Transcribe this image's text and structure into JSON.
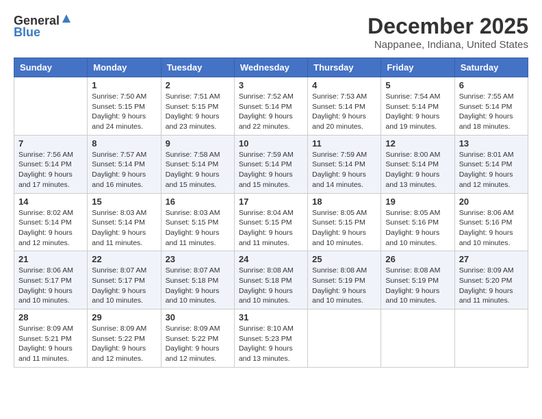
{
  "header": {
    "logo_general": "General",
    "logo_blue": "Blue",
    "title": "December 2025",
    "location": "Nappanee, Indiana, United States"
  },
  "days_of_week": [
    "Sunday",
    "Monday",
    "Tuesday",
    "Wednesday",
    "Thursday",
    "Friday",
    "Saturday"
  ],
  "weeks": [
    [
      {
        "day": "",
        "info": ""
      },
      {
        "day": "1",
        "info": "Sunrise: 7:50 AM\nSunset: 5:15 PM\nDaylight: 9 hours\nand 24 minutes."
      },
      {
        "day": "2",
        "info": "Sunrise: 7:51 AM\nSunset: 5:15 PM\nDaylight: 9 hours\nand 23 minutes."
      },
      {
        "day": "3",
        "info": "Sunrise: 7:52 AM\nSunset: 5:14 PM\nDaylight: 9 hours\nand 22 minutes."
      },
      {
        "day": "4",
        "info": "Sunrise: 7:53 AM\nSunset: 5:14 PM\nDaylight: 9 hours\nand 20 minutes."
      },
      {
        "day": "5",
        "info": "Sunrise: 7:54 AM\nSunset: 5:14 PM\nDaylight: 9 hours\nand 19 minutes."
      },
      {
        "day": "6",
        "info": "Sunrise: 7:55 AM\nSunset: 5:14 PM\nDaylight: 9 hours\nand 18 minutes."
      }
    ],
    [
      {
        "day": "7",
        "info": "Sunrise: 7:56 AM\nSunset: 5:14 PM\nDaylight: 9 hours\nand 17 minutes."
      },
      {
        "day": "8",
        "info": "Sunrise: 7:57 AM\nSunset: 5:14 PM\nDaylight: 9 hours\nand 16 minutes."
      },
      {
        "day": "9",
        "info": "Sunrise: 7:58 AM\nSunset: 5:14 PM\nDaylight: 9 hours\nand 15 minutes."
      },
      {
        "day": "10",
        "info": "Sunrise: 7:59 AM\nSunset: 5:14 PM\nDaylight: 9 hours\nand 15 minutes."
      },
      {
        "day": "11",
        "info": "Sunrise: 7:59 AM\nSunset: 5:14 PM\nDaylight: 9 hours\nand 14 minutes."
      },
      {
        "day": "12",
        "info": "Sunrise: 8:00 AM\nSunset: 5:14 PM\nDaylight: 9 hours\nand 13 minutes."
      },
      {
        "day": "13",
        "info": "Sunrise: 8:01 AM\nSunset: 5:14 PM\nDaylight: 9 hours\nand 12 minutes."
      }
    ],
    [
      {
        "day": "14",
        "info": "Sunrise: 8:02 AM\nSunset: 5:14 PM\nDaylight: 9 hours\nand 12 minutes."
      },
      {
        "day": "15",
        "info": "Sunrise: 8:03 AM\nSunset: 5:14 PM\nDaylight: 9 hours\nand 11 minutes."
      },
      {
        "day": "16",
        "info": "Sunrise: 8:03 AM\nSunset: 5:15 PM\nDaylight: 9 hours\nand 11 minutes."
      },
      {
        "day": "17",
        "info": "Sunrise: 8:04 AM\nSunset: 5:15 PM\nDaylight: 9 hours\nand 11 minutes."
      },
      {
        "day": "18",
        "info": "Sunrise: 8:05 AM\nSunset: 5:15 PM\nDaylight: 9 hours\nand 10 minutes."
      },
      {
        "day": "19",
        "info": "Sunrise: 8:05 AM\nSunset: 5:16 PM\nDaylight: 9 hours\nand 10 minutes."
      },
      {
        "day": "20",
        "info": "Sunrise: 8:06 AM\nSunset: 5:16 PM\nDaylight: 9 hours\nand 10 minutes."
      }
    ],
    [
      {
        "day": "21",
        "info": "Sunrise: 8:06 AM\nSunset: 5:17 PM\nDaylight: 9 hours\nand 10 minutes."
      },
      {
        "day": "22",
        "info": "Sunrise: 8:07 AM\nSunset: 5:17 PM\nDaylight: 9 hours\nand 10 minutes."
      },
      {
        "day": "23",
        "info": "Sunrise: 8:07 AM\nSunset: 5:18 PM\nDaylight: 9 hours\nand 10 minutes."
      },
      {
        "day": "24",
        "info": "Sunrise: 8:08 AM\nSunset: 5:18 PM\nDaylight: 9 hours\nand 10 minutes."
      },
      {
        "day": "25",
        "info": "Sunrise: 8:08 AM\nSunset: 5:19 PM\nDaylight: 9 hours\nand 10 minutes."
      },
      {
        "day": "26",
        "info": "Sunrise: 8:08 AM\nSunset: 5:19 PM\nDaylight: 9 hours\nand 10 minutes."
      },
      {
        "day": "27",
        "info": "Sunrise: 8:09 AM\nSunset: 5:20 PM\nDaylight: 9 hours\nand 11 minutes."
      }
    ],
    [
      {
        "day": "28",
        "info": "Sunrise: 8:09 AM\nSunset: 5:21 PM\nDaylight: 9 hours\nand 11 minutes."
      },
      {
        "day": "29",
        "info": "Sunrise: 8:09 AM\nSunset: 5:22 PM\nDaylight: 9 hours\nand 12 minutes."
      },
      {
        "day": "30",
        "info": "Sunrise: 8:09 AM\nSunset: 5:22 PM\nDaylight: 9 hours\nand 12 minutes."
      },
      {
        "day": "31",
        "info": "Sunrise: 8:10 AM\nSunset: 5:23 PM\nDaylight: 9 hours\nand 13 minutes."
      },
      {
        "day": "",
        "info": ""
      },
      {
        "day": "",
        "info": ""
      },
      {
        "day": "",
        "info": ""
      }
    ]
  ]
}
